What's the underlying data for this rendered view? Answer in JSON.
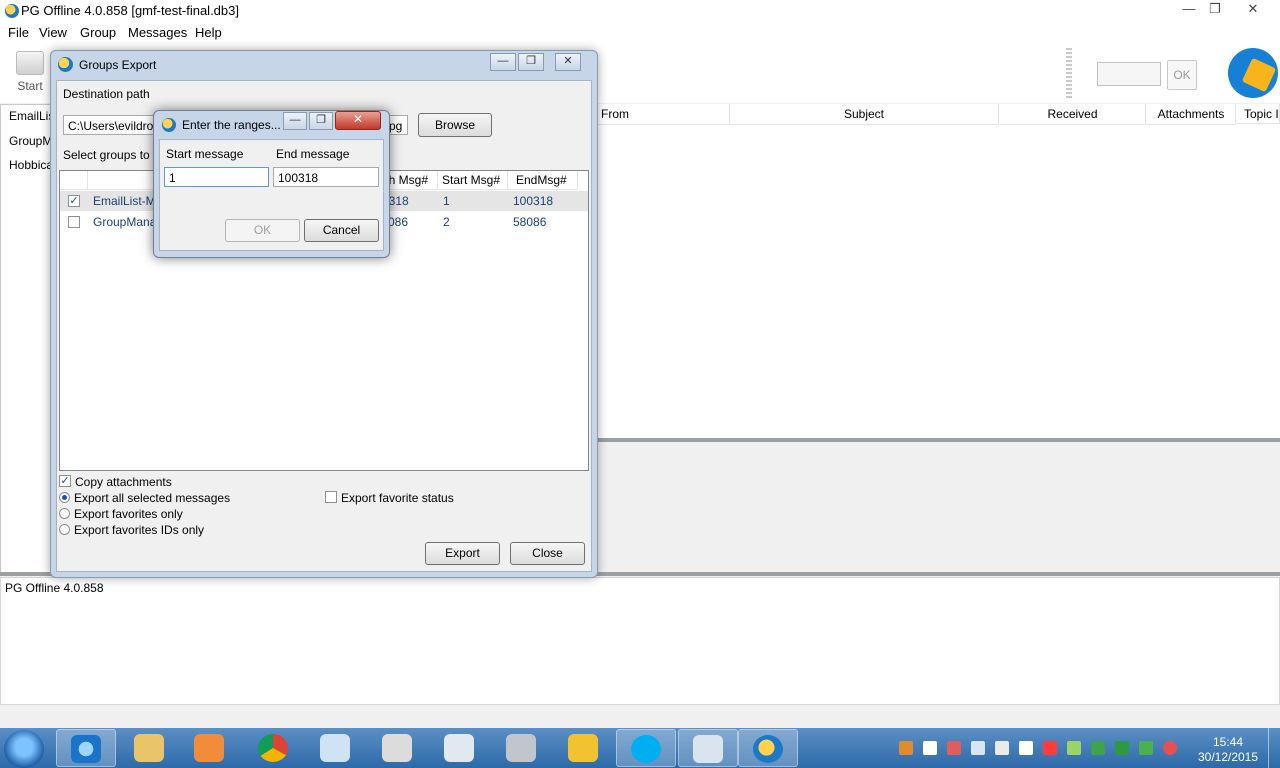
{
  "window": {
    "title": "PG Offline 4.0.858  [gmf-test-final.db3]"
  },
  "menu": [
    "File",
    "View",
    "Group",
    "Messages",
    "Help"
  ],
  "toolbar": {
    "start_label": "Start",
    "ok_label": "OK"
  },
  "groups": [
    "EmailList-Mail",
    "GroupManager",
    "Hobbicat"
  ],
  "message_columns": [
    "From",
    "Subject",
    "Received",
    "Attachments",
    "Topic I"
  ],
  "log": {
    "text": "PG Offline 4.0.858"
  },
  "groups_export": {
    "title": "Groups Export",
    "destination_label": "Destination path",
    "destination_value": "C:\\Users\\evildro",
    "destination_suffix": "pg",
    "browse_label": "Browse",
    "select_label": "Select groups to",
    "columns": [
      "",
      "",
      "gh Msg#",
      "Start Msg#",
      "EndMsg#"
    ],
    "rows": [
      {
        "checked": true,
        "name": "EmailList-M",
        "high": "0318",
        "start": "1",
        "end": "100318"
      },
      {
        "checked": false,
        "name": "GroupMana",
        "high": "086",
        "start": "2",
        "end": "58086"
      }
    ],
    "copy_attachments_label": "Copy attachments",
    "export_all_label": "Export all selected messages",
    "export_favorites_label": "Export favorites only",
    "export_fav_ids_label": "Export favorites IDs only",
    "export_fav_status_label": "Export favorite status",
    "export_button": "Export",
    "close_button": "Close"
  },
  "ranges_dialog": {
    "title": "Enter the ranges...",
    "start_label": "Start message",
    "end_label": "End message",
    "start_value": "1",
    "end_value": "100318",
    "ok_button": "OK",
    "cancel_button": "Cancel"
  },
  "taskbar": {
    "time": "15:44",
    "date": "30/12/2015"
  }
}
